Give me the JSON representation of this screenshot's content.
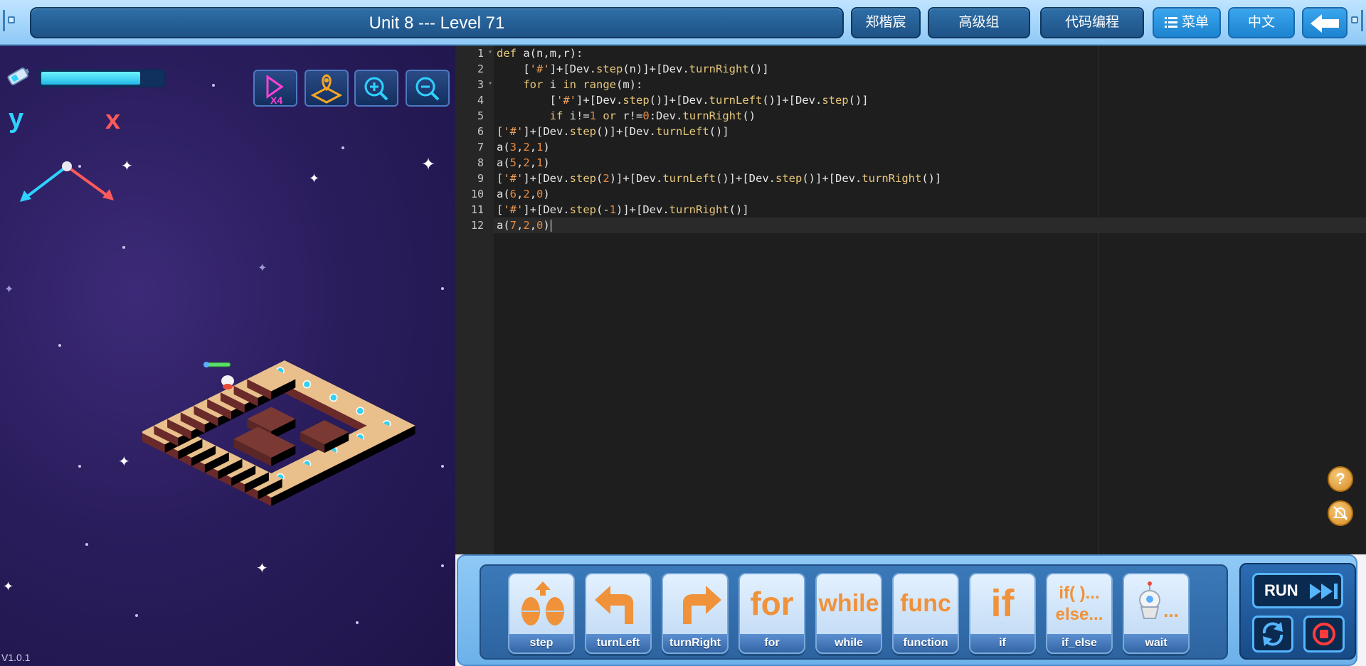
{
  "header": {
    "title": "Unit 8 --- Level 71",
    "user_name": "郑楷宸",
    "group": "高级组",
    "mode": "代码编程",
    "menu_label": "菜单",
    "language_label": "中文",
    "back_icon": "back-arrow-icon"
  },
  "game": {
    "energy_level": 0.8,
    "controls": [
      "speed-x4-icon",
      "map-pin-icon",
      "zoom-in-icon",
      "zoom-out-icon"
    ],
    "speed_label": "X4",
    "axis_y_label": "y",
    "axis_x_label": "x",
    "version": "V1.0.1"
  },
  "editor": {
    "line_numbers": [
      "1",
      "2",
      "3",
      "4",
      "5",
      "6",
      "7",
      "8",
      "9",
      "10",
      "11",
      "12"
    ],
    "lines": [
      "def a(n,m,r):",
      "    ['#']+[Dev.step(n)]+[Dev.turnRight()]",
      "    for i in range(m):",
      "        ['#']+[Dev.step()]+[Dev.turnLeft()]+[Dev.step()]",
      "        if i!=1 or r!=0:Dev.turnRight()",
      "['#']+[Dev.step()]+[Dev.turnLeft()]",
      "a(3,2,1)",
      "a(5,2,1)",
      "['#']+[Dev.step(2)]+[Dev.turnLeft()]+[Dev.step()]+[Dev.turnRight()]",
      "a(6,2,0)",
      "['#']+[Dev.step(-1)]+[Dev.turnRight()]",
      "a(7,2,0)"
    ],
    "help_icon": "help-icon",
    "mute_icon": "bell-mute-icon"
  },
  "toolbox": {
    "blocks": [
      {
        "label": "step",
        "art": "",
        "icon": "step-footprints-icon"
      },
      {
        "label": "turnLeft",
        "art": "",
        "icon": "turn-left-arrow-icon"
      },
      {
        "label": "turnRight",
        "art": "",
        "icon": "turn-right-arrow-icon"
      },
      {
        "label": "for",
        "art": "for",
        "icon": ""
      },
      {
        "label": "while",
        "art": "while",
        "icon": ""
      },
      {
        "label": "function",
        "art": "func",
        "icon": ""
      },
      {
        "label": "if",
        "art": "if",
        "icon": ""
      },
      {
        "label": "if_else",
        "art": "if( )...\nelse...",
        "icon": ""
      },
      {
        "label": "wait",
        "art": "...",
        "icon": "robot-wait-icon"
      }
    ],
    "run_label": "RUN",
    "reset_icon": "reset-icon",
    "stop_icon": "stop-icon"
  }
}
